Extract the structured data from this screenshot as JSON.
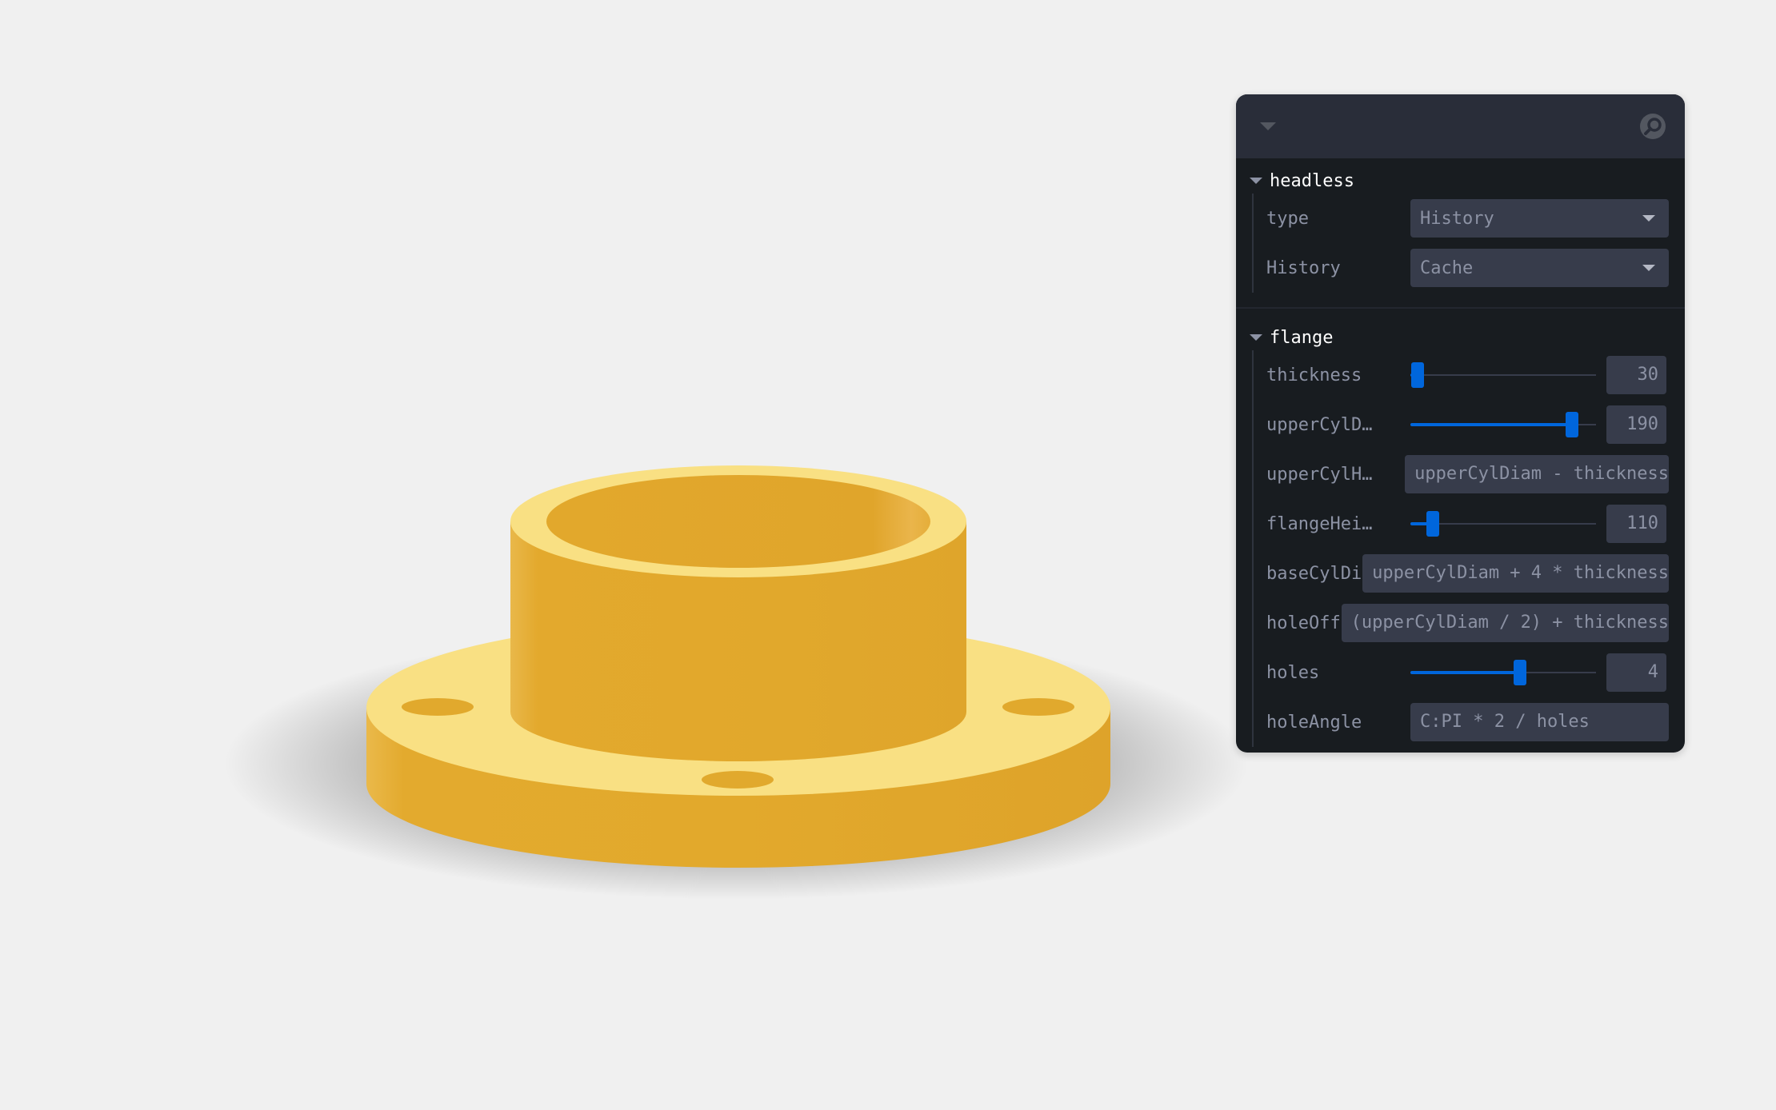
{
  "scene": {
    "model": "flange",
    "colors": {
      "background": "#f0f0f0",
      "part_top": "#f9e083",
      "part_side": "#e2a92c",
      "part_inner": "#e0a62c",
      "hole": "#e1a92d"
    }
  },
  "panel": {
    "header": {
      "collapse_icon": "chevron-down-icon",
      "search_icon": "search-icon"
    },
    "folders": {
      "headless": {
        "title": "headless",
        "type_label": "type",
        "type_value": "History",
        "history_label": "History",
        "history_value": "Cache"
      },
      "flange": {
        "title": "flange",
        "thickness_label": "thickness",
        "thickness_value": "30",
        "thickness_fraction": 0.04,
        "upper_cyl_diam_label": "upperCylD…",
        "upper_cyl_diam_value": "190",
        "upper_cyl_diam_fraction": 0.87,
        "upper_cyl_height_label": "upperCylH…",
        "upper_cyl_height_value": "upperCylDiam - thickness",
        "flange_height_label": "flangeHei…",
        "flange_height_value": "110",
        "flange_height_fraction": 0.12,
        "base_cyl_diam_label": "baseCylDi…",
        "base_cyl_diam_value": "upperCylDiam + 4 * thickness",
        "hole_offset_label": "holeOffset",
        "hole_offset_value": "(upperCylDiam / 2) + thickness",
        "holes_label": "holes",
        "holes_value": "4",
        "holes_fraction": 0.59,
        "hole_angle_label": "holeAngle",
        "hole_angle_value": "C:PI * 2 / holes"
      }
    }
  }
}
